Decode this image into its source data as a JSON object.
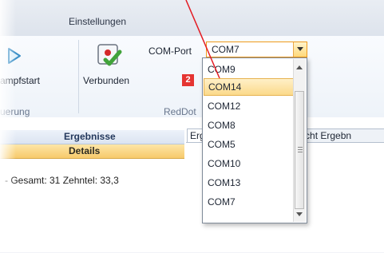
{
  "ribbon": {
    "tab": "Einstellungen",
    "fight_start_label": "ampfstart",
    "connected_label": "Verbunden",
    "group_left_label": "uerung",
    "group_red_label": "RedDot",
    "com_port_label": "COM-Port",
    "com_port_value": "COM7"
  },
  "badge": "2",
  "left_panel": {
    "header": "Ergebnisse",
    "selected": "Details",
    "summary": "- Gesamt: 31 Zehntel: 33,3"
  },
  "right_panel": {
    "tab1": "Erg",
    "tab2": "ckansicht Ergebn"
  },
  "dropdown": {
    "options": [
      "COM9",
      "COM14",
      "COM12",
      "COM8",
      "COM5",
      "COM10",
      "COM13",
      "COM7"
    ],
    "selected_index": 1
  },
  "colors": {
    "accent": "#ef9b1b",
    "selection": "#fbd98a",
    "badge": "#e53532",
    "annotation_line": "#e31b23"
  }
}
